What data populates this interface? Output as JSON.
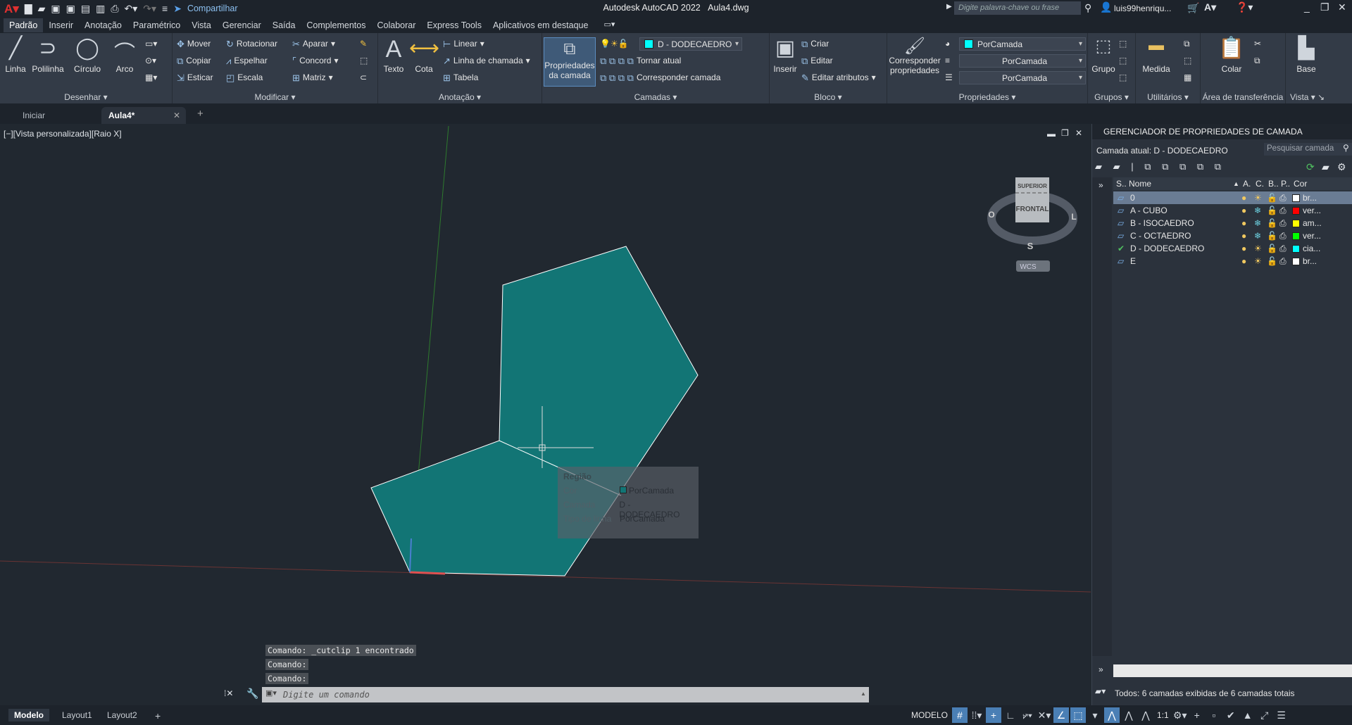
{
  "app": {
    "title": "Autodesk AutoCAD 2022",
    "file": "Aula4.dwg",
    "share": "Compartilhar",
    "search_placeholder": "Digite palavra-chave ou frase",
    "user": "luis99henriqu..."
  },
  "menu_tabs": [
    "Padrão",
    "Inserir",
    "Anotação",
    "Paramétrico",
    "Vista",
    "Gerenciar",
    "Saída",
    "Complementos",
    "Colaborar",
    "Express Tools",
    "Aplicativos em destaque"
  ],
  "ribbon": {
    "desenhar": {
      "title": "Desenhar",
      "linha": "Linha",
      "polilinha": "Polilinha",
      "circulo": "Círculo",
      "arco": "Arco"
    },
    "modificar": {
      "title": "Modificar",
      "mover": "Mover",
      "rotacionar": "Rotacionar",
      "aparar": "Aparar",
      "copiar": "Copiar",
      "espelhar": "Espelhar",
      "concord": "Concord",
      "esticar": "Esticar",
      "escala": "Escala",
      "matriz": "Matriz"
    },
    "anotacao": {
      "title": "Anotação",
      "texto": "Texto",
      "cota": "Cota",
      "linear": "Linear",
      "linha_chamada": "Linha de chamada",
      "tabela": "Tabela"
    },
    "camadas": {
      "title": "Camadas",
      "propriedades": "Propriedades da camada",
      "current_layer": "D - DODECAEDRO",
      "tornar_atual": "Tornar atual",
      "corresponder": "Corresponder camada"
    },
    "bloco": {
      "title": "Bloco",
      "inserir": "Inserir",
      "criar": "Criar",
      "editar": "Editar",
      "editar_atributos": "Editar atributos"
    },
    "propriedades": {
      "title": "Propriedades",
      "corresponder": "Corresponder propriedades",
      "cor": "PorCamada",
      "tipo_linha": "PorCamada",
      "espessura": "PorCamada"
    },
    "grupos": {
      "title": "Grupos",
      "grupo": "Grupo"
    },
    "utilitarios": {
      "title": "Utilitários",
      "medida": "Medida"
    },
    "area": {
      "title": "Área de transferência",
      "colar": "Colar"
    },
    "vista": {
      "title": "Vista",
      "base": "Base"
    }
  },
  "doc_tabs": {
    "iniciar": "Iniciar",
    "active": "Aula4*"
  },
  "viewport": {
    "label": "[−][Vista personalizada][Raio X]",
    "viewcube": {
      "top": "SUPERIOR",
      "front": "FRONTAL",
      "west": "O",
      "east": "L",
      "south": "S",
      "ucs": "WCS"
    }
  },
  "tooltip": {
    "title": "Região",
    "rows": [
      {
        "k": "Cor",
        "v": "PorCamada"
      },
      {
        "k": "Camada",
        "v": "D - DODECAEDRO"
      },
      {
        "k": "Tipo de linha",
        "v": "PorCamada"
      }
    ]
  },
  "command": {
    "history": [
      "Comando:  _cutclip 1 encontrado",
      "Comando:",
      "Comando:"
    ],
    "placeholder": "Digite um comando"
  },
  "layer_panel": {
    "title": "GERENCIADOR DE PROPRIEDADES DE CAMADA",
    "current": "Camada atual: D - DODECAEDRO",
    "search": "Pesquisar camada",
    "cols": [
      "S..",
      "Nome",
      "A.",
      "C.",
      "B..",
      "P..",
      "Cor"
    ],
    "layers": [
      {
        "name": "0",
        "color": "#ffffff",
        "color_name": "br...",
        "frozen": false,
        "current": false,
        "selected": true
      },
      {
        "name": "A - CUBO",
        "color": "#ff0000",
        "color_name": "ver...",
        "frozen": true,
        "current": false
      },
      {
        "name": "B - ISOCAEDRO",
        "color": "#ffff00",
        "color_name": "am...",
        "frozen": true,
        "current": false
      },
      {
        "name": "C - OCTAEDRO",
        "color": "#00ff00",
        "color_name": "ver...",
        "frozen": true,
        "current": false
      },
      {
        "name": "D - DODECAEDRO",
        "color": "#00ffff",
        "color_name": "cia...",
        "frozen": false,
        "current": true
      },
      {
        "name": "E",
        "color": "#ffffff",
        "color_name": "br...",
        "frozen": false,
        "current": false
      }
    ],
    "footer": "Todos: 6 camadas exibidas de 6 camadas totais"
  },
  "status": {
    "tabs": [
      "Modelo",
      "Layout1",
      "Layout2"
    ],
    "modelo": "MODELO",
    "scale": "1:1"
  },
  "colors": {
    "region_fill": "#127575",
    "accent": "#4a7fb5"
  }
}
